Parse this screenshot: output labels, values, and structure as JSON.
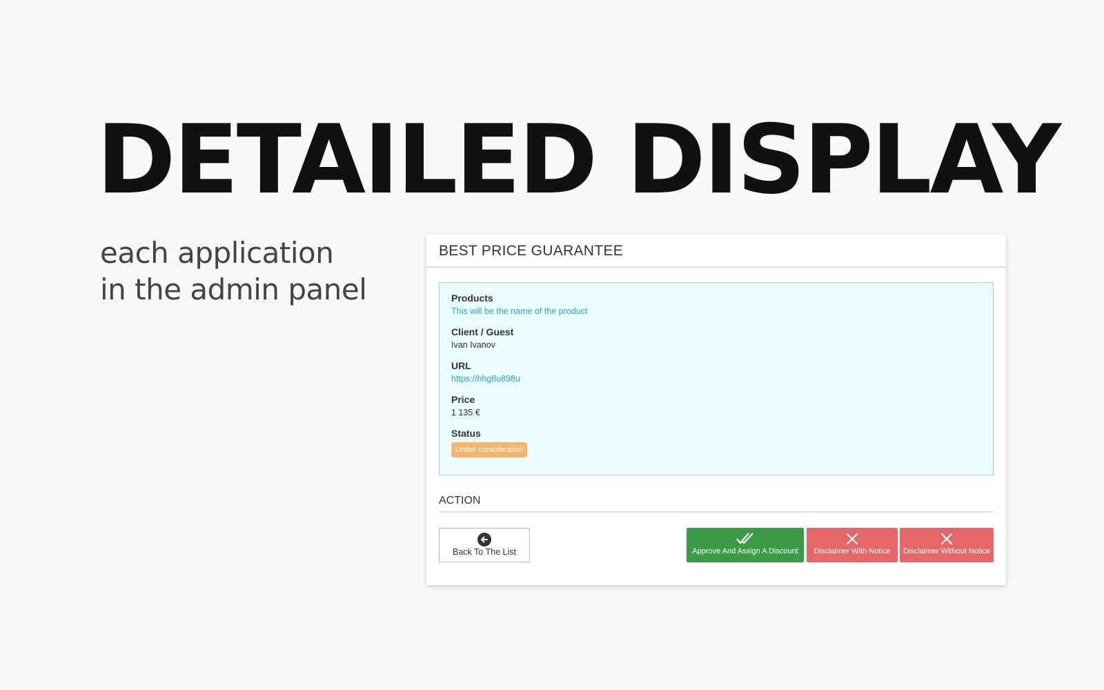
{
  "hero": {
    "title": "DETAILED DISPLAY",
    "subtitle_line1": "each application",
    "subtitle_line2": "in the admin panel"
  },
  "card": {
    "title": "BEST PRICE GUARANTEE",
    "fields": [
      {
        "label": "Products",
        "value": "This will be the name of the product"
      },
      {
        "label": "Client / Guest",
        "value": "Ivan Ivanov"
      },
      {
        "label": "URL",
        "value": "https://hhg8u898u"
      },
      {
        "label": "Price",
        "value": "1 135 €"
      },
      {
        "label": "Status",
        "value": "Under consideration"
      }
    ],
    "action_title": "ACTION"
  },
  "buttons": {
    "back": {
      "label": "Back To The List",
      "icon": "arrow-left-circle-icon"
    },
    "approve": {
      "label": "Approve And Assign A Discount",
      "icon": "double-check-icon"
    },
    "notice": {
      "label": "Disclaimer With Notice",
      "icon": "close-icon"
    },
    "without_notice": {
      "label": "Disclaimer Without Notice",
      "icon": "close-icon"
    }
  },
  "colors": {
    "approve": "#3c9b47",
    "disclaimer": "#e56767",
    "status_badge": "#f7b56a",
    "link": "#2aa9bf",
    "info_box_bg": "#ebfcfe"
  }
}
